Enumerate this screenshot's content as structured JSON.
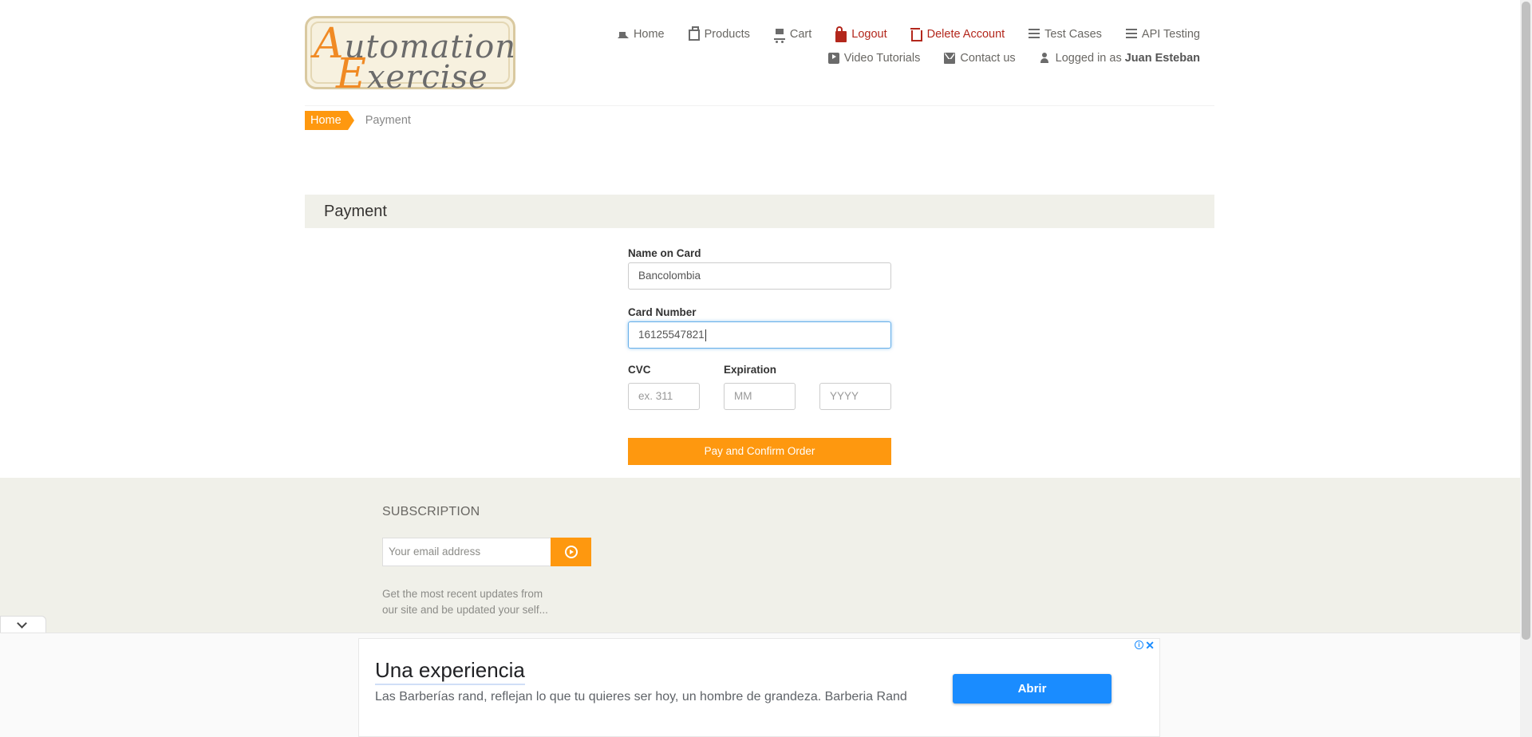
{
  "header": {
    "logo": {
      "line1_cap": "A",
      "line1_rest": "utomation",
      "line2_cap": "E",
      "line2_rest": "xercise"
    },
    "nav_row1": [
      {
        "icon": "home-icon",
        "label": "Home",
        "danger": false
      },
      {
        "icon": "products-icon",
        "label": "Products",
        "danger": false
      },
      {
        "icon": "cart-icon",
        "label": "Cart",
        "danger": false
      },
      {
        "icon": "lock-icon",
        "label": "Logout",
        "danger": true
      },
      {
        "icon": "trash-icon",
        "label": "Delete Account",
        "danger": true
      },
      {
        "icon": "list-icon",
        "label": "Test Cases",
        "danger": false
      },
      {
        "icon": "list-icon",
        "label": "API Testing",
        "danger": false
      }
    ],
    "nav_row2": {
      "video": "Video Tutorials",
      "contact": "Contact us",
      "logged_prefix": "Logged in as",
      "username": "Juan Esteban"
    }
  },
  "breadcrumb": {
    "home": "Home",
    "current": "Payment"
  },
  "payment": {
    "heading": "Payment",
    "name_label": "Name on Card",
    "name_value": "Bancolombia",
    "card_label": "Card Number",
    "card_value": "16125547821",
    "cvc_label": "CVC",
    "cvc_placeholder": "ex. 311",
    "expiration_label": "Expiration",
    "month_placeholder": "MM",
    "year_placeholder": "YYYY",
    "submit_label": "Pay and Confirm Order"
  },
  "footer": {
    "subscription_title": "SUBSCRIPTION",
    "email_placeholder": "Your email address",
    "description": "Get the most recent updates from our site and be updated your self..."
  },
  "ad": {
    "title": "Una experiencia",
    "text": "Las Barberías rand, reflejan lo que tu quieres ser hoy, un hombre de grandeza. Barberia Rand",
    "button": "Abrir",
    "info": "i",
    "close": "✕"
  },
  "colors": {
    "accent": "#fe980f",
    "danger": "#b3271c",
    "ad_button": "#1a8cff",
    "panel": "#f0f0e9"
  }
}
